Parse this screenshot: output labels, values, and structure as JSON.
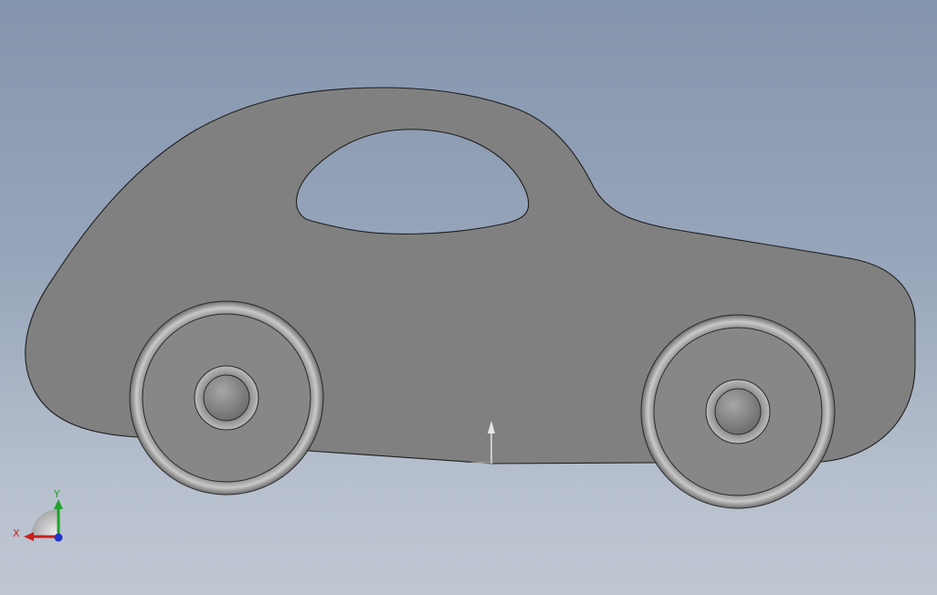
{
  "scene": {
    "background_top": "#8495ad",
    "background_bottom": "#c0c7d3",
    "body_color": "#808080",
    "edge_color": "#1e1e1e",
    "wheel_color": "#8a8a8a"
  },
  "triad": {
    "x_label": "X",
    "y_label": "Y",
    "x_color": "#c8201e",
    "y_color": "#1fa12b",
    "z_color": "#2233cc"
  }
}
